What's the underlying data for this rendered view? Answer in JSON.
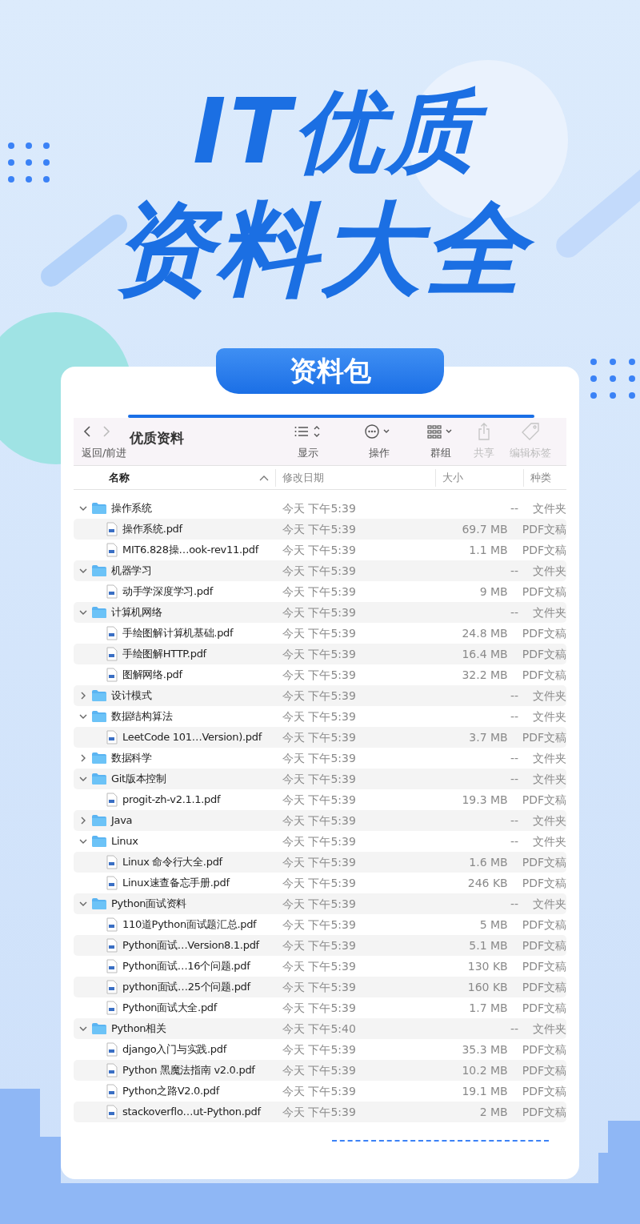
{
  "headline": {
    "lines": [
      "IT优质",
      "资料大全"
    ]
  },
  "banner": {
    "label": "资料包"
  },
  "window": {
    "title": "优质资料",
    "nav_label": "返回/前进",
    "toolbar": [
      {
        "kind": "view",
        "label": "显示",
        "disabled": false
      },
      {
        "kind": "action",
        "label": "操作",
        "disabled": false
      },
      {
        "kind": "group",
        "label": "群组",
        "disabled": false
      },
      {
        "kind": "share",
        "label": "共享",
        "disabled": true
      },
      {
        "kind": "tag",
        "label": "编辑标签",
        "disabled": true
      }
    ]
  },
  "columns": [
    {
      "label": "名称",
      "sorted": true
    },
    {
      "label": "修改日期",
      "sorted": false
    },
    {
      "label": "大小",
      "sorted": false
    },
    {
      "label": "种类",
      "sorted": false
    }
  ],
  "items": [
    {
      "kind": "folder",
      "name": "操作系统",
      "date": "今天 下午5:39",
      "size": "--",
      "type": "文件夹",
      "expanded": true,
      "children": [
        {
          "kind": "file",
          "name": "操作系统.pdf",
          "date": "今天 下午5:39",
          "size": "69.7 MB",
          "type": "PDF文稿"
        },
        {
          "kind": "file",
          "name": "MIT6.828操…ook-rev11.pdf",
          "date": "今天 下午5:39",
          "size": "1.1 MB",
          "type": "PDF文稿"
        }
      ]
    },
    {
      "kind": "folder",
      "name": "机器学习",
      "date": "今天 下午5:39",
      "size": "--",
      "type": "文件夹",
      "expanded": true,
      "children": [
        {
          "kind": "file",
          "name": "动手学深度学习.pdf",
          "date": "今天 下午5:39",
          "size": "9 MB",
          "type": "PDF文稿"
        }
      ]
    },
    {
      "kind": "folder",
      "name": "计算机网络",
      "date": "今天 下午5:39",
      "size": "--",
      "type": "文件夹",
      "expanded": true,
      "children": [
        {
          "kind": "file",
          "name": "手绘图解计算机基础.pdf",
          "date": "今天 下午5:39",
          "size": "24.8 MB",
          "type": "PDF文稿"
        },
        {
          "kind": "file",
          "name": "手绘图解HTTP.pdf",
          "date": "今天 下午5:39",
          "size": "16.4 MB",
          "type": "PDF文稿"
        },
        {
          "kind": "file",
          "name": "图解网络.pdf",
          "date": "今天 下午5:39",
          "size": "32.2 MB",
          "type": "PDF文稿"
        }
      ]
    },
    {
      "kind": "folder",
      "name": "设计模式",
      "date": "今天 下午5:39",
      "size": "--",
      "type": "文件夹",
      "expanded": false
    },
    {
      "kind": "folder",
      "name": "数据结构算法",
      "date": "今天 下午5:39",
      "size": "--",
      "type": "文件夹",
      "expanded": true,
      "children": [
        {
          "kind": "file",
          "name": "LeetCode 101…Version).pdf",
          "date": "今天 下午5:39",
          "size": "3.7 MB",
          "type": "PDF文稿"
        }
      ]
    },
    {
      "kind": "folder",
      "name": "数据科学",
      "date": "今天 下午5:39",
      "size": "--",
      "type": "文件夹",
      "expanded": false
    },
    {
      "kind": "folder",
      "name": "Git版本控制",
      "date": "今天 下午5:39",
      "size": "--",
      "type": "文件夹",
      "expanded": true,
      "children": [
        {
          "kind": "file",
          "name": "progit-zh-v2.1.1.pdf",
          "date": "今天 下午5:39",
          "size": "19.3 MB",
          "type": "PDF文稿"
        }
      ]
    },
    {
      "kind": "folder",
      "name": "Java",
      "date": "今天 下午5:39",
      "size": "--",
      "type": "文件夹",
      "expanded": false
    },
    {
      "kind": "folder",
      "name": "Linux",
      "date": "今天 下午5:39",
      "size": "--",
      "type": "文件夹",
      "expanded": true,
      "children": [
        {
          "kind": "file",
          "name": "Linux 命令行大全.pdf",
          "date": "今天 下午5:39",
          "size": "1.6 MB",
          "type": "PDF文稿"
        },
        {
          "kind": "file",
          "name": "Linux速查备忘手册.pdf",
          "date": "今天 下午5:39",
          "size": "246 KB",
          "type": "PDF文稿"
        }
      ]
    },
    {
      "kind": "folder",
      "name": "Python面试资料",
      "date": "今天 下午5:39",
      "size": "--",
      "type": "文件夹",
      "expanded": true,
      "children": [
        {
          "kind": "file",
          "name": "110道Python面试题汇总.pdf",
          "date": "今天 下午5:39",
          "size": "5 MB",
          "type": "PDF文稿"
        },
        {
          "kind": "file",
          "name": "Python面试…Version8.1.pdf",
          "date": "今天 下午5:39",
          "size": "5.1 MB",
          "type": "PDF文稿"
        },
        {
          "kind": "file",
          "name": "Python面试…16个问题.pdf",
          "date": "今天 下午5:39",
          "size": "130 KB",
          "type": "PDF文稿"
        },
        {
          "kind": "file",
          "name": "python面试…25个问题.pdf",
          "date": "今天 下午5:39",
          "size": "160 KB",
          "type": "PDF文稿"
        },
        {
          "kind": "file",
          "name": "Python面试大全.pdf",
          "date": "今天 下午5:39",
          "size": "1.7 MB",
          "type": "PDF文稿"
        }
      ]
    },
    {
      "kind": "folder",
      "name": "Python相关",
      "date": "今天 下午5:40",
      "size": "--",
      "type": "文件夹",
      "expanded": true,
      "children": [
        {
          "kind": "file",
          "name": "django入门与实践.pdf",
          "date": "今天 下午5:39",
          "size": "35.3 MB",
          "type": "PDF文稿"
        },
        {
          "kind": "file",
          "name": "Python 黑魔法指南 v2.0.pdf",
          "date": "今天 下午5:39",
          "size": "10.2 MB",
          "type": "PDF文稿"
        },
        {
          "kind": "file",
          "name": "Python之路V2.0.pdf",
          "date": "今天 下午5:39",
          "size": "19.1 MB",
          "type": "PDF文稿"
        },
        {
          "kind": "file",
          "name": "stackoverflo…ut-Python.pdf",
          "date": "今天 下午5:39",
          "size": "2 MB",
          "type": "PDF文稿"
        }
      ]
    }
  ]
}
